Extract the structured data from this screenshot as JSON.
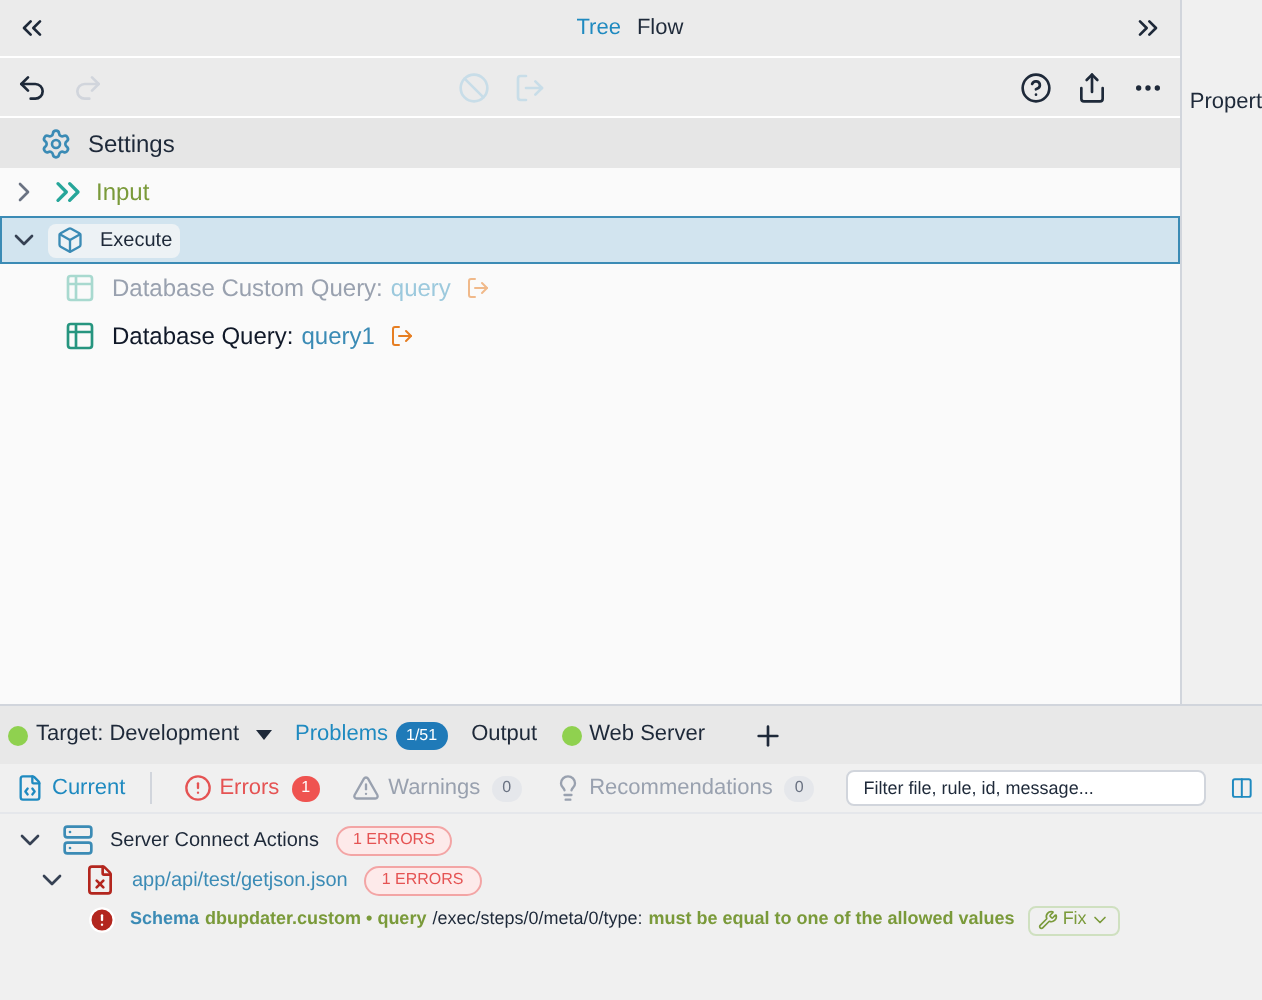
{
  "header": {
    "tabs": [
      {
        "label": "Tree",
        "selected": true
      },
      {
        "label": "Flow",
        "selected": false
      }
    ]
  },
  "toolbar": {
    "undo_disabled": false,
    "redo_disabled": true,
    "disable_disabled": true,
    "exit_disabled": true
  },
  "side_panel": {
    "title": "Propert"
  },
  "tree": [
    {
      "kind": "settings",
      "label": "Settings",
      "selected": false
    },
    {
      "kind": "input",
      "label": "Input",
      "expanded": false,
      "selected": false
    },
    {
      "kind": "execute",
      "label": "Execute",
      "expanded": true,
      "selected": true,
      "children": [
        {
          "label": "Database Custom Query:",
          "value": "query",
          "disabled": true
        },
        {
          "label": "Database Query:",
          "value": "query1",
          "disabled": false
        }
      ]
    }
  ],
  "bottom_tabs": [
    {
      "kind": "target",
      "label": "Target:",
      "value": "Development",
      "color": "#8fd14f"
    },
    {
      "kind": "tab",
      "label": "Problems",
      "badge": "1/51",
      "selected": true
    },
    {
      "kind": "tab",
      "label": "Output",
      "selected": false
    },
    {
      "kind": "server",
      "label": "Web Server",
      "color": "#8fd14f"
    }
  ],
  "filters": [
    {
      "kind": "current",
      "label": "Current",
      "selected": true
    },
    {
      "kind": "errors",
      "label": "Errors",
      "count": "1",
      "selected": true
    },
    {
      "kind": "warnings",
      "label": "Warnings",
      "count": "0",
      "selected": false
    },
    {
      "kind": "recommendations",
      "label": "Recommendations",
      "count": "0",
      "selected": false
    }
  ],
  "filter_field": {
    "placeholder": "Filter file, rule, id, message..."
  },
  "problems": [
    {
      "kind": "group",
      "label": "Server Connect Actions",
      "badge": "1 ERRORS",
      "expanded": true,
      "children": [
        {
          "kind": "file",
          "label": "app/api/test/getjson.json",
          "badge": "1 ERRORS",
          "expanded": true,
          "children": [
            {
              "kind": "error",
              "parts": [
                {
                  "kind": "source",
                  "text": "Schema"
                },
                {
                  "kind": "rule",
                  "text": "dbupdater.custom • query"
                },
                {
                  "kind": "path",
                  "text": "/exec/steps/0/meta/0/type:"
                },
                {
                  "kind": "message",
                  "text": "must be equal to one of the allowed values"
                }
              ],
              "fix": "Fix"
            }
          ]
        }
      ]
    }
  ]
}
